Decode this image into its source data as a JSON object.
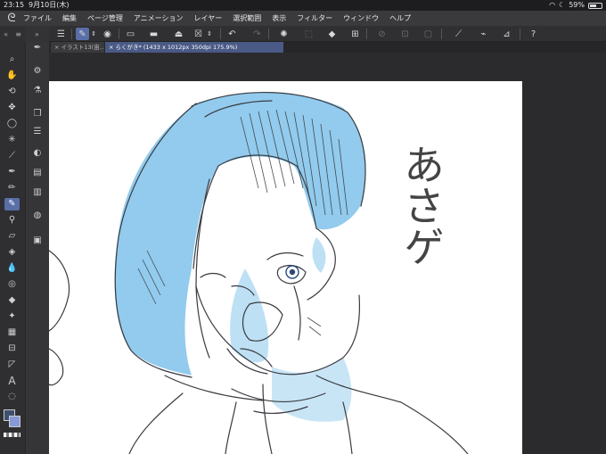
{
  "status": {
    "time": "23:15",
    "date": "9月10日(木)",
    "battery": "59%",
    "battery_level": 0.59
  },
  "menu": {
    "items": [
      "ファイル",
      "編集",
      "ページ管理",
      "アニメーション",
      "レイヤー",
      "選択範囲",
      "表示",
      "フィルター",
      "ウィンドウ",
      "ヘルプ"
    ]
  },
  "tabs": [
    {
      "label": "イラスト13(宙…",
      "active": false
    },
    {
      "label": "らくがき* (1433 x 1012px 350dpi 175.9%)",
      "active": true
    }
  ],
  "canvas": {
    "handwritten_text": "あさゲ"
  },
  "colors": {
    "accent": "#5a6ea8",
    "main_color": "#3f4f6e",
    "sub_color": "#8799d6",
    "hair_color": "#79bde8"
  }
}
